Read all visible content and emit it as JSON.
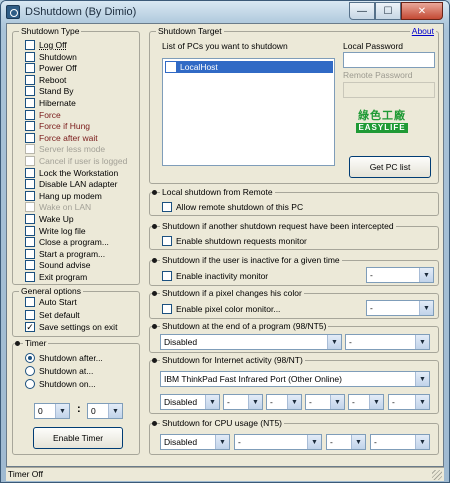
{
  "window": {
    "title": "DShutdown (By Dimio)",
    "min_label": "—",
    "max_label": "☐",
    "close_label": "✕"
  },
  "shutdown_type": {
    "title": "Shutdown Type",
    "items": [
      {
        "label": "Log Off",
        "checked": false,
        "state": "normal"
      },
      {
        "label": "Shutdown",
        "checked": false,
        "state": "normal"
      },
      {
        "label": "Power Off",
        "checked": false,
        "state": "normal"
      },
      {
        "label": "Reboot",
        "checked": false,
        "state": "normal"
      },
      {
        "label": "Stand By",
        "checked": false,
        "state": "normal"
      },
      {
        "label": "Hibernate",
        "checked": false,
        "state": "normal"
      },
      {
        "label": "Force",
        "checked": false,
        "state": "red"
      },
      {
        "label": "Force if Hung",
        "checked": false,
        "state": "red"
      },
      {
        "label": "Force after wait",
        "checked": false,
        "state": "red"
      },
      {
        "label": "Server less mode",
        "checked": false,
        "state": "disabled"
      },
      {
        "label": "Cancel if user is logged",
        "checked": false,
        "state": "disabled"
      },
      {
        "label": "Lock the Workstation",
        "checked": false,
        "state": "normal"
      },
      {
        "label": "Disable LAN adapter",
        "checked": false,
        "state": "normal"
      },
      {
        "label": "Hang up modem",
        "checked": false,
        "state": "normal"
      },
      {
        "label": "Wake on LAN",
        "checked": false,
        "state": "disabled"
      },
      {
        "label": "Wake Up",
        "checked": false,
        "state": "normal"
      },
      {
        "label": "Write log file",
        "checked": false,
        "state": "normal"
      },
      {
        "label": "Close a program...",
        "checked": false,
        "state": "normal"
      },
      {
        "label": "Start a program...",
        "checked": false,
        "state": "normal"
      },
      {
        "label": "Sound advise",
        "checked": false,
        "state": "normal"
      },
      {
        "label": "Exit program",
        "checked": false,
        "state": "normal"
      }
    ]
  },
  "general_options": {
    "title": "General options",
    "items": [
      {
        "label": "Auto Start",
        "checked": false
      },
      {
        "label": "Set default",
        "checked": false
      },
      {
        "label": "Save settings on exit",
        "checked": true
      }
    ]
  },
  "timer": {
    "title": "Timer",
    "radios": [
      {
        "label": "Shutdown after...",
        "selected": true
      },
      {
        "label": "Shutdown at...",
        "selected": false
      },
      {
        "label": "Shutdown on...",
        "selected": false
      }
    ],
    "hours_value": "0",
    "minutes_value": "0",
    "separator": ":",
    "enable_button": "Enable Timer"
  },
  "shutdown_target": {
    "title": "Shutdown Target",
    "about_link": "About",
    "list_label": "List of PCs you want to shutdown",
    "pcs": [
      {
        "label": "LocalHost",
        "checked": true
      }
    ],
    "local_password_label": "Local Password",
    "remote_password_label": "Remote Password",
    "logo_cn": "綠色工廠",
    "logo_en": "EASYLIFE",
    "get_pc_list_button": "Get PC list"
  },
  "sections": {
    "local_remote": {
      "title": "Local shutdown from Remote",
      "checkbox": "Allow remote shutdown of this PC"
    },
    "intercepted": {
      "title": "Shutdown if another shutdown request have been intercepted",
      "checkbox": "Enable shutdown requests monitor"
    },
    "inactive": {
      "title": "Shutdown if the user is inactive for a given time",
      "checkbox": "Enable inactivity monitor",
      "dropdown": "-"
    },
    "pixel": {
      "title": "Shutdown if a pixel changes his color",
      "checkbox": "Enable pixel color monitor...",
      "dropdown": "-"
    },
    "program_end": {
      "title": "Shutdown at the end of a program (98/NT5)",
      "dropdown1": "Disabled",
      "dropdown2": "-"
    },
    "internet": {
      "title": "Shutdown for Internet activity (98/NT)",
      "adapter": "IBM ThinkPad Fast Infrared Port (Other Online)",
      "mode": "Disabled",
      "d1": "-",
      "d2": "-",
      "d3": "-",
      "d4": "-",
      "d5": "-"
    },
    "cpu": {
      "title": "Shutdown for CPU usage (NT5)",
      "mode": "Disabled",
      "d1": "-",
      "d2": "-",
      "d3": "-"
    }
  },
  "status": {
    "text": "Timer Off"
  }
}
